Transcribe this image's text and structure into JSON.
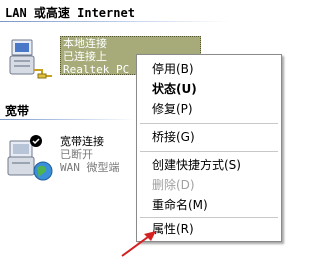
{
  "sections": {
    "lan_title": "LAN 或高速 Internet",
    "broadband_title": "宽带"
  },
  "connections": {
    "local": {
      "name": "本地连接",
      "status": "已连接上",
      "device": "Realtek PC"
    },
    "broadband": {
      "name": "宽带连接",
      "status": "已断开",
      "device": "WAN 微型端"
    }
  },
  "context_menu": {
    "items": [
      {
        "label": "停用(B)"
      },
      {
        "label": "状态(U)"
      },
      {
        "label": "修复(P)"
      },
      {
        "label": "桥接(G)"
      },
      {
        "label": "创建快捷方式(S)"
      },
      {
        "label": "删除(D)"
      },
      {
        "label": "重命名(M)"
      },
      {
        "label": "属性(R)"
      }
    ]
  },
  "colors": {
    "selection": "#a6ab79",
    "arrow": "#d42020",
    "separator": "#7a96c8"
  }
}
